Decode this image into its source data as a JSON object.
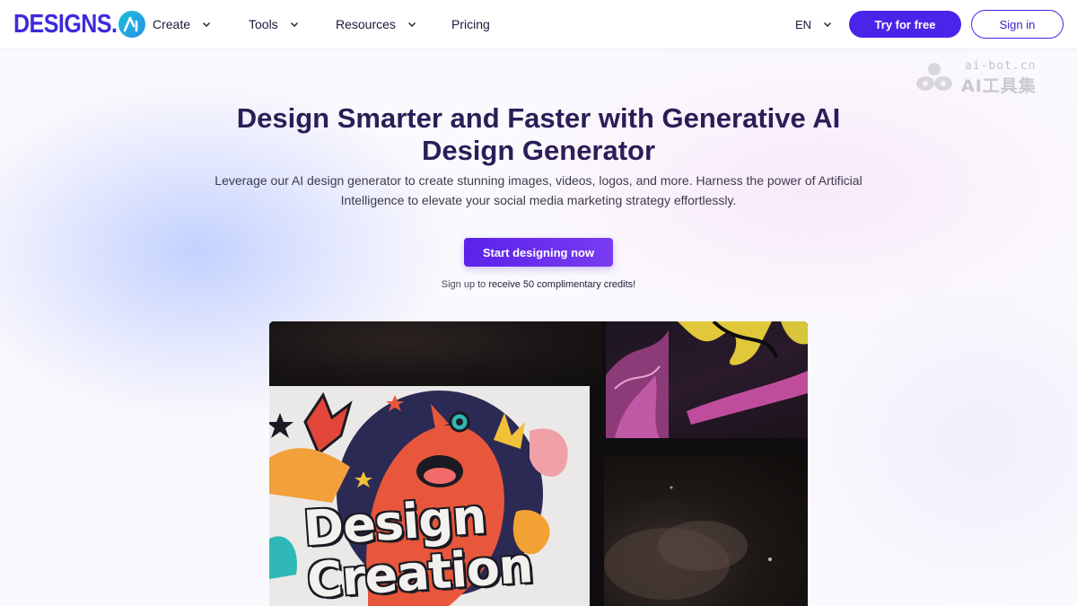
{
  "header": {
    "logo_text": "DESIGNS.",
    "nav": [
      {
        "label": "Create",
        "dropdown": true
      },
      {
        "label": "Tools",
        "dropdown": true
      },
      {
        "label": "Resources",
        "dropdown": true
      },
      {
        "label": "Pricing",
        "dropdown": false
      }
    ],
    "language": "EN",
    "try_label": "Try for free",
    "signin_label": "Sign in"
  },
  "watermark": {
    "line1": "ai-bot.cn",
    "line2": "AI工具集"
  },
  "hero": {
    "title_line1": "Design Smarter and Faster with Generative AI",
    "title_line2": "Design Generator",
    "subtitle": "Leverage our AI design generator to create stunning images, videos, logos, and more. Harness the power of Artificial Intelligence to elevate your social media marketing strategy effortlessly.",
    "cta_label": "Start designing now",
    "credits_prefix": "Sign up to",
    "credits_emph": "receive 50 complimentary credits!"
  },
  "showcase": {
    "poster_text": "Design Creation"
  },
  "colors": {
    "brand": "#4a24e8",
    "title": "#2b1e58",
    "logo_badge": "#19c1d8"
  }
}
